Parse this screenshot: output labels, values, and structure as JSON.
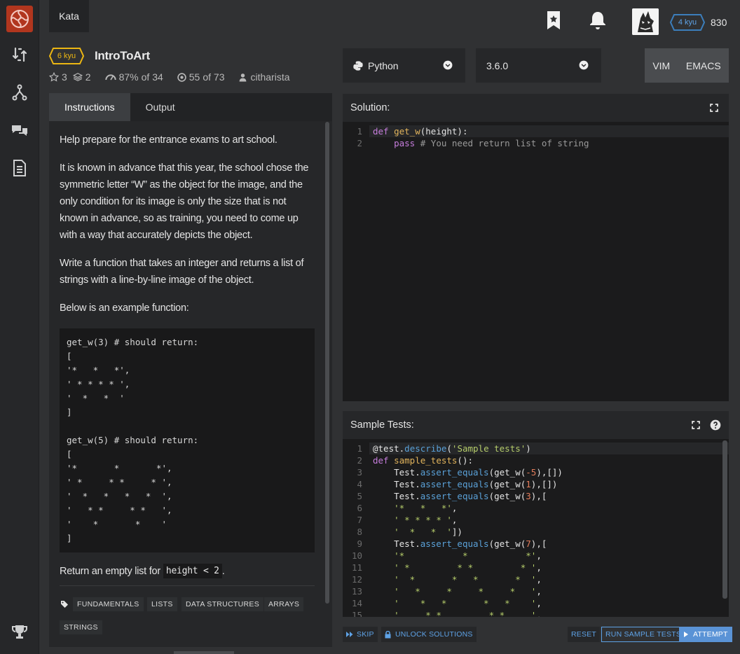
{
  "topbar": {
    "kata_tab": "Kata",
    "honor": "830",
    "user_rank": "4 kyu"
  },
  "kata": {
    "rank": "6 kyu",
    "title": "IntroToArt",
    "stars": "3",
    "collections": "2",
    "satisfaction_pct": "87%",
    "satisfaction_of": "of 34",
    "completed": "55",
    "completed_of": "of 73",
    "author": "citharista"
  },
  "language": {
    "name": "Python",
    "version": "3.6.0"
  },
  "modes": [
    "VIM",
    "EMACS"
  ],
  "instructions": {
    "tabs": [
      "Instructions",
      "Output"
    ],
    "paragraphs": [
      "Help prepare for the entrance exams to art school.",
      "It is known in advance that this year, the school chose the symmetric letter “W” as the object for the image, and the only condition for its image is only the size that is not known in advance, so as training, you need to come up with a way that accurately depicts the object.",
      "Write a function that takes an integer and returns a list of strings with a line-by-line image of the object.",
      "Below is an example function:"
    ],
    "example_code": "get_w(3) # should return:\n[\n'*   *   *',\n' * * * * ',\n'  *   *  '\n]\n\nget_w(5) # should return:\n[\n'*       *       *',\n' *     * *     * ',\n'  *   *   *   *  ',\n'   * *     * *   ',\n'    *       *    '\n]",
    "return_text": "Return an empty list for",
    "return_code": "height < 2",
    "return_end": ".",
    "tags": [
      "FUNDAMENTALS",
      "LISTS",
      "DATA STRUCTURES",
      "ARRAYS",
      "STRINGS"
    ]
  },
  "solution": {
    "header": "Solution:",
    "line_numbers": [
      "1",
      "2"
    ]
  },
  "tests": {
    "header": "Sample Tests:",
    "line_numbers": [
      "1",
      "2",
      "3",
      "4",
      "5",
      "6",
      "7",
      "8",
      "9",
      "10",
      "11",
      "12",
      "13",
      "14",
      "15"
    ]
  },
  "footer": {
    "skip": "SKIP",
    "unlock": "UNLOCK SOLUTIONS",
    "reset": "RESET",
    "run": "RUN SAMPLE TESTS",
    "attempt": "ATTEMPT"
  },
  "colors": {
    "rank_yellow": "#ecb613",
    "rank_blue": "#3c7ebb",
    "accent_blue": "#5ea2e6",
    "logo_red": "#b1361e"
  }
}
